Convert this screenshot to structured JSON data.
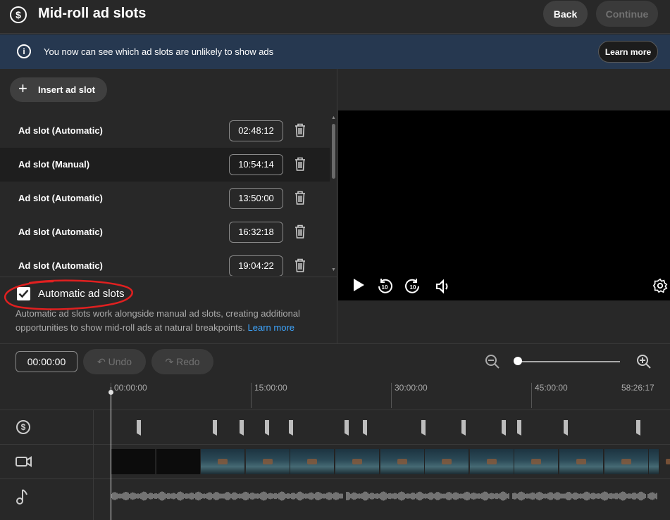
{
  "header": {
    "title": "Mid-roll ad slots",
    "back_label": "Back",
    "continue_label": "Continue"
  },
  "banner": {
    "message": "You now can see which ad slots are unlikely to show ads",
    "learn_more_label": "Learn more"
  },
  "ad_slots": {
    "insert_label": "Insert ad slot",
    "items": [
      {
        "label": "Ad slot (Automatic)",
        "time": "02:48:12"
      },
      {
        "label": "Ad slot (Manual)",
        "time": "10:54:14"
      },
      {
        "label": "Ad slot (Automatic)",
        "time": "13:50:00"
      },
      {
        "label": "Ad slot (Automatic)",
        "time": "16:32:18"
      },
      {
        "label": "Ad slot (Automatic)",
        "time": "19:04:22"
      }
    ],
    "selected_index": 1
  },
  "automatic": {
    "checked": true,
    "label": "Automatic ad slots",
    "description": "Automatic ad slots work alongside manual ad slots, creating additional opportunities to show mid-roll ads at natural breakpoints.",
    "link_label": "Learn more"
  },
  "toolbar": {
    "current_time": "00:00:00",
    "undo_label": "Undo",
    "redo_label": "Redo"
  },
  "timeline": {
    "ruler_labels": [
      "00:00:00",
      "15:00:00",
      "30:00:00",
      "45:00:00",
      "58:26:17"
    ]
  },
  "colors": {
    "background": "#282828",
    "banner": "#263850",
    "link": "#3ea6ff",
    "annotation": "#e02020"
  }
}
